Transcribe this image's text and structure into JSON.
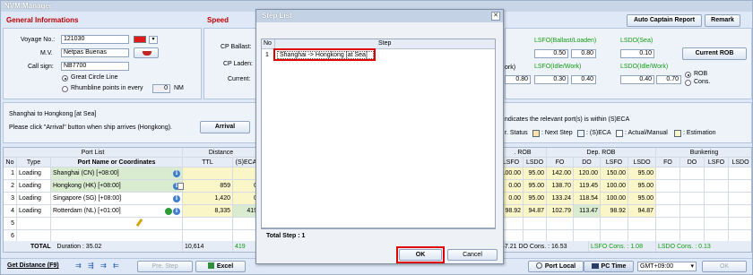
{
  "app": {
    "title": "NVM Manager"
  },
  "colors": {
    "accent_red": "#c00000",
    "highlight_red": "#e00000",
    "yellow_cell": "#fbf6c8",
    "green_cell": "#d9ecd0",
    "info_blue": "#3f7fd0"
  },
  "general": {
    "section_title": "General Informations",
    "voyage_label": "Voyage No.:",
    "voyage_value": "121030",
    "mv_label": "M.V.",
    "mv_value": "Netpas Buenas",
    "callsign_label": "Call sign:",
    "callsign_value": "NB7700",
    "great_circle": "Great Circle Line",
    "rhumbline": "Rhumbline points in every",
    "rhumb_value": "0",
    "rhumb_unit": "NM"
  },
  "speed": {
    "section_title": "Speed",
    "cp_ballast": "CP Ballast:",
    "cp_laden": "CP Laden:",
    "current": "Current:"
  },
  "top_buttons": {
    "auto_captain": "Auto Captain Report",
    "remark": "Remark"
  },
  "cons": {
    "work_partial_1": "ork)",
    "work_partial_2": "ork)",
    "lsfo_ballast_laden": "LSFO(Ballast/Loaden)",
    "lsdo_sea": "LSDO(Sea)",
    "lsfo_idle_work": "LSFO(Idle/Work)",
    "lsdo_idle_work": "LSDO(Idle/Work)",
    "v_080a": "0.80",
    "v_050": "0.50",
    "v_080b": "0.80",
    "v_010": "0.10",
    "v_030": "0.30",
    "v_040a": "0.40",
    "v_040b": "0.40",
    "v_070": "0.70",
    "current_rob_btn": "Current ROB",
    "rob": "ROB",
    "cons_radio": "Cons."
  },
  "status_line": {
    "route": "Shanghai to Hongkong [at Sea]",
    "hint": "Please click \"Arrival\" button when ship arrives (Hongkong).",
    "arrival_btn": "Arrival",
    "eca_note": "ndicates the relevant port(s) is within (S)ECA",
    "legend_status": "r. Status",
    "legend_next": ": Next Step",
    "legend_seca": ": (S)ECA",
    "legend_actual": ": Actual/Manual",
    "legend_estimation": ": Estimation"
  },
  "grid": {
    "group_port_list": "Port List",
    "group_distance": "Distance",
    "group_rob": ". ROB",
    "group_dep_rob": "Dep. ROB",
    "group_bunkering": "Bunkering",
    "h_no": "No",
    "h_type": "Type",
    "h_port": "Port Name or Coordinates",
    "h_ttl": "TTL",
    "h_seca": "(S)ECA",
    "h_rob": [
      "LSFO",
      "LSDO"
    ],
    "h_dep": [
      "FO",
      "DO",
      "LSFO",
      "LSDO"
    ],
    "h_bunk": [
      "FO",
      "DO",
      "LSFO",
      "LSDO"
    ],
    "rows": [
      {
        "no": "1",
        "type": "Loading",
        "port": "Shanghai (CN) [+08:00]",
        "ttl": "",
        "seca": "",
        "rob": [
          "100.00",
          "95.00"
        ],
        "dep": [
          "142.00",
          "120.00",
          "150.00",
          "95.00"
        ]
      },
      {
        "no": "2",
        "type": "Loading",
        "port": "Hongkong (HK) [+08:00]",
        "ttl": "859",
        "seca": "0",
        "rob": [
          "0.00",
          "95.00"
        ],
        "dep": [
          "138.70",
          "119.45",
          "100.00",
          "95.00"
        ]
      },
      {
        "no": "3",
        "type": "Loading",
        "port": "Singapore (SG) [+08:00]",
        "ttl": "1,420",
        "seca": "0",
        "rob": [
          "0.00",
          "95.00"
        ],
        "dep": [
          "133.24",
          "118.54",
          "100.00",
          "95.00"
        ]
      },
      {
        "no": "4",
        "type": "Loading",
        "port": "Rotterdam (NL) [+01:00]",
        "ttl": "8,335",
        "seca": "419",
        "rob": [
          "98.92",
          "94.87"
        ],
        "dep": [
          "102.79",
          "113.47",
          "98.92",
          "94.87"
        ]
      },
      {
        "no": "5",
        "type": "",
        "port": "",
        "ttl": "",
        "seca": "",
        "rob": [
          "",
          ""
        ],
        "dep": [
          "",
          "",
          "",
          ""
        ]
      },
      {
        "no": "6",
        "type": "",
        "port": "",
        "ttl": "",
        "seca": "",
        "rob": [
          "",
          ""
        ],
        "dep": [
          "",
          "",
          "",
          ""
        ]
      }
    ],
    "total_label": "TOTAL",
    "total_duration": "Duration : 35.02",
    "total_ttl": "10,614",
    "total_seca": "419",
    "total_right": "47.21  DO Cons. : 16.53",
    "total_lsfo": "LSFO Cons. : 1.08",
    "total_lsdo": "LSDO Cons. : 0.13"
  },
  "statusbar": {
    "get_distance": "Get Distance (F9)",
    "pre_step": "Pre. Step",
    "excel": "Excel",
    "port_local": "Port Local",
    "pc_time": "PC Time",
    "tz": "GMT+09:00",
    "ok": "OK"
  },
  "dialog": {
    "title": "Step List",
    "col_no": "No",
    "col_step": "Step",
    "steps": [
      {
        "no": "1",
        "step": "Shanghai -> Hongkong [at Sea]"
      }
    ],
    "total_step": "Total Step : 1",
    "ok": "OK",
    "cancel": "Cancel"
  }
}
